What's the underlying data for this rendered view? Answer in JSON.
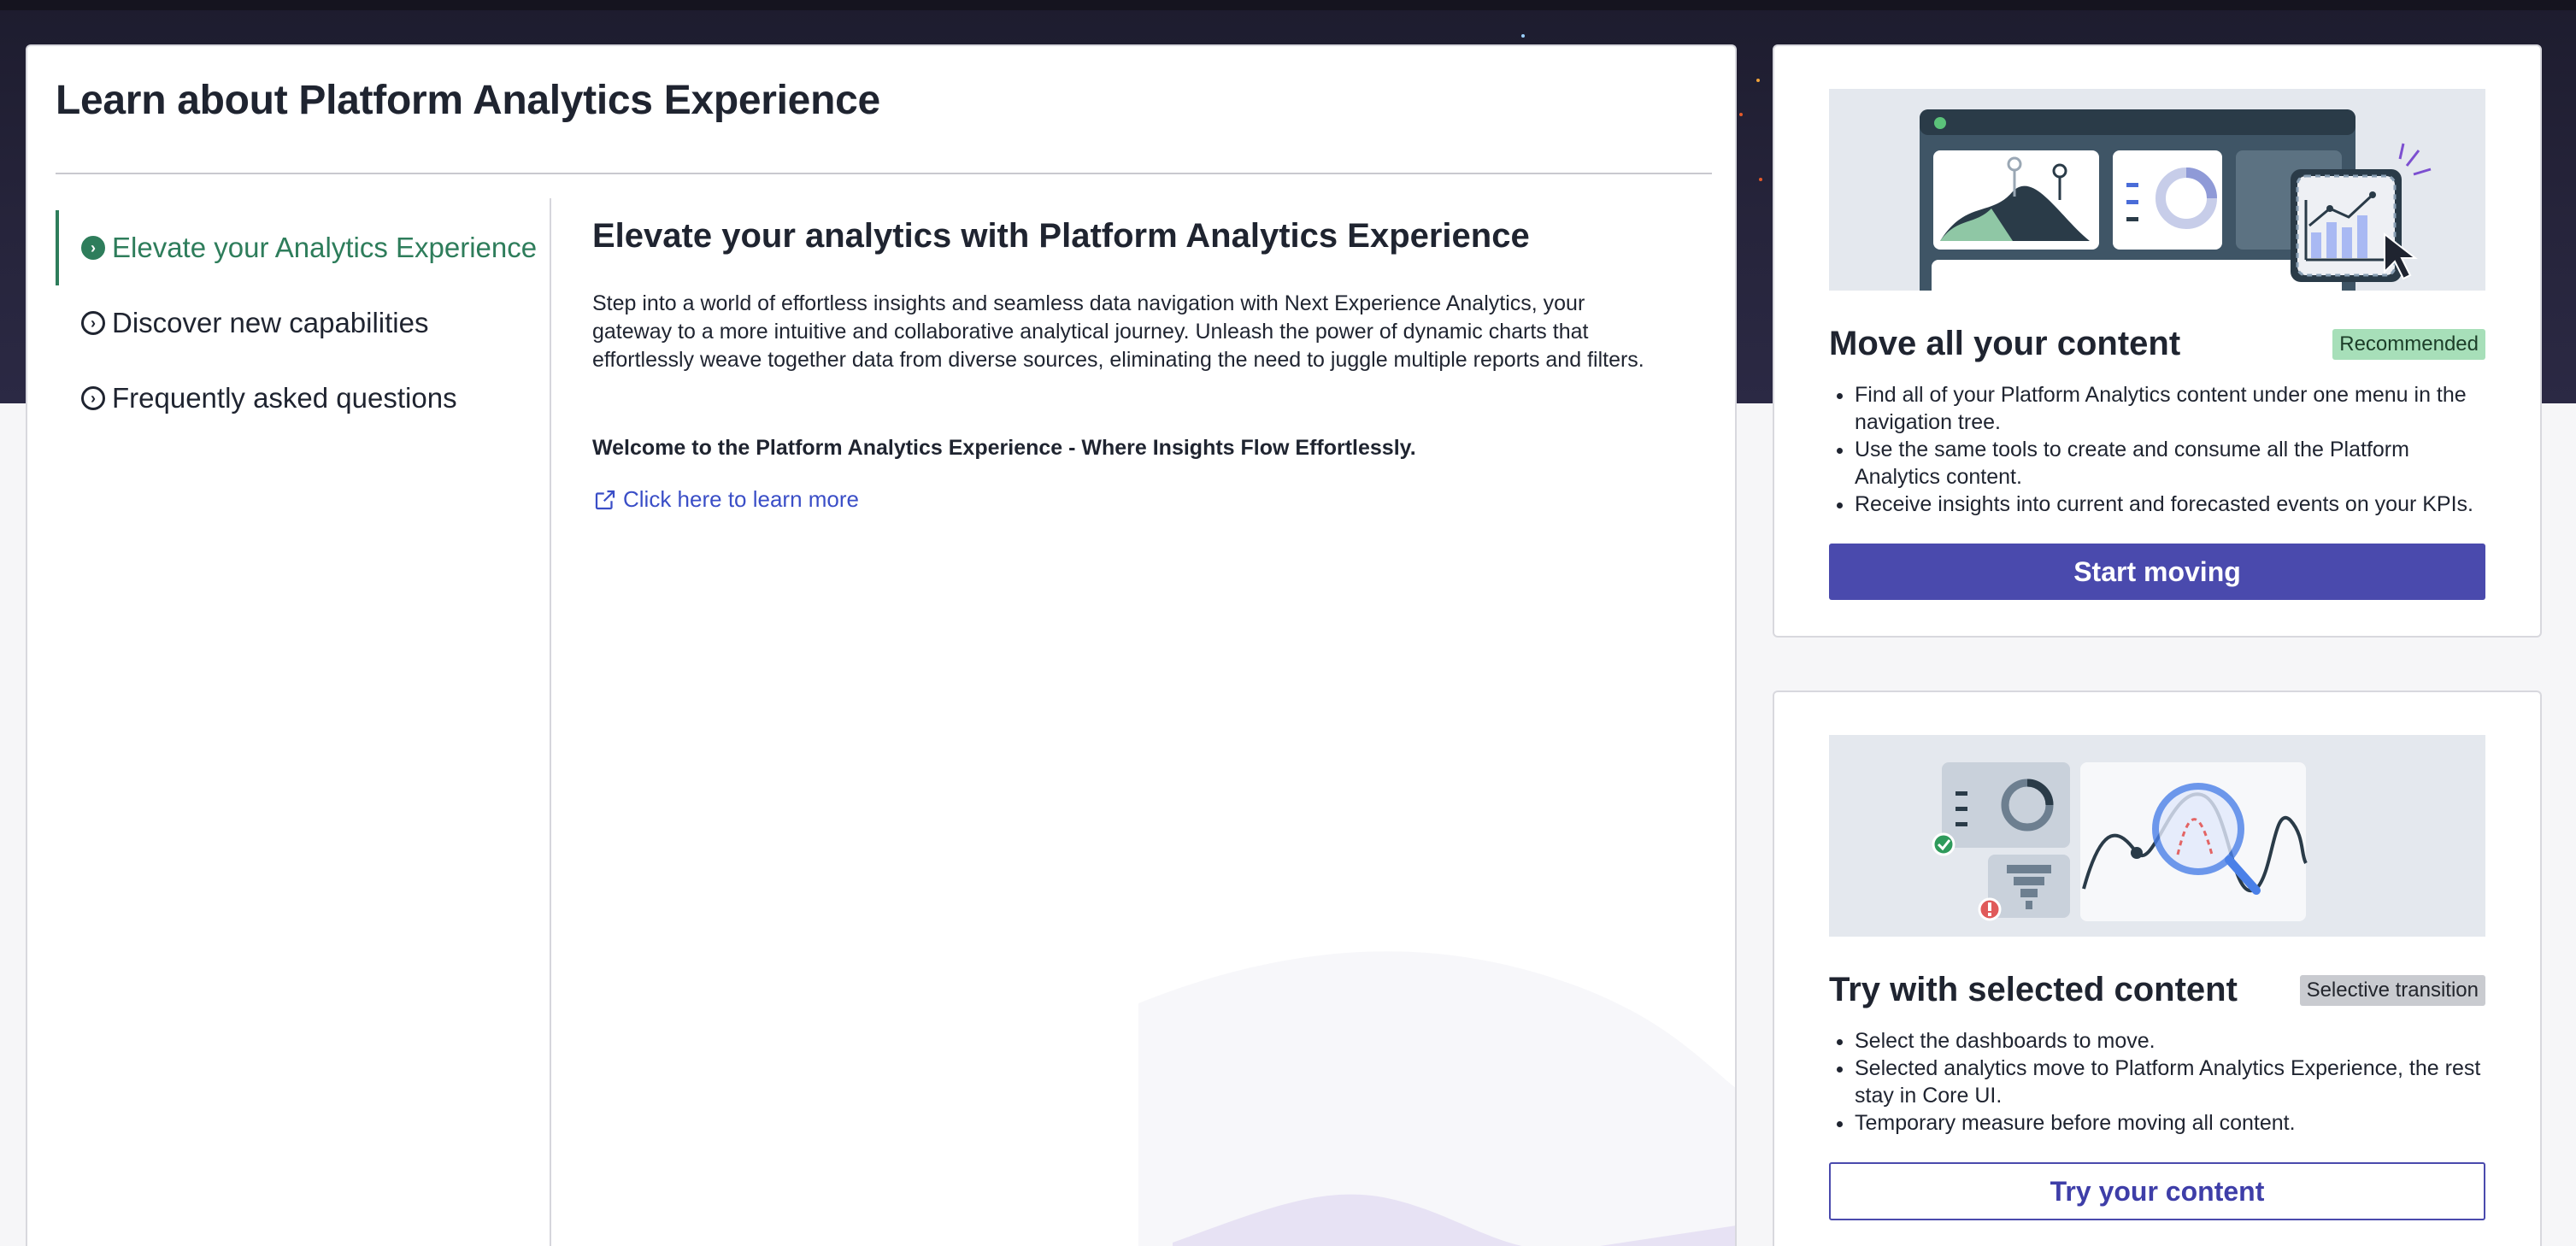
{
  "main": {
    "title": "Learn about Platform Analytics Experience",
    "nav": [
      {
        "label": "Elevate your Analytics Experience",
        "active": true
      },
      {
        "label": "Discover new capabilities",
        "active": false
      },
      {
        "label": "Frequently asked questions",
        "active": false
      }
    ],
    "content": {
      "heading": "Elevate your analytics with Platform Analytics Experience",
      "body": "Step into a world of effortless insights and seamless data navigation with Next Experience Analytics, your gateway to a more intuitive and collaborative analytical journey. Unleash the power of dynamic charts that effortlessly weave together data from diverse sources, eliminating the need to juggle multiple reports and filters.",
      "welcome": "Welcome to the Platform Analytics Experience - Where Insights Flow Effortlessly.",
      "link_label": "Click here to learn more"
    }
  },
  "cards": [
    {
      "title": "Move all your content",
      "badge": "Recommended",
      "bullets": [
        "Find all of your Platform Analytics content under one menu in the navigation tree.",
        "Use the same tools to create and consume all the Platform Analytics content.",
        "Receive insights into current and forecasted events on your KPIs."
      ],
      "button": "Start moving"
    },
    {
      "title": "Try with selected content",
      "badge": "Selective transition",
      "bullets": [
        "Select the dashboards to move.",
        "Selected analytics move to Platform Analytics Experience, the rest stay in Core UI.",
        "Temporary measure before moving all content."
      ],
      "button": "Try your content"
    }
  ],
  "icons": {
    "nav_active": "chevron-right-circle-filled-icon",
    "nav_inactive": "chevron-right-circle-icon",
    "link": "external-link-icon"
  },
  "colors": {
    "accent_green": "#2e7d5b",
    "primary_button": "#4a4aad",
    "link": "#3a4ec7",
    "hero_bg": "#26243b"
  }
}
